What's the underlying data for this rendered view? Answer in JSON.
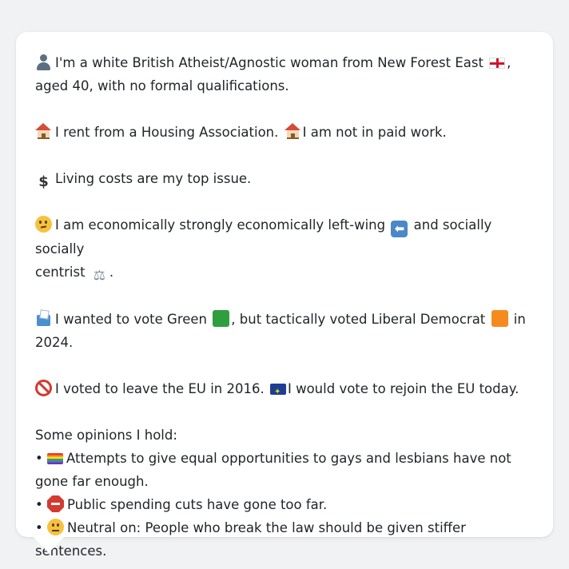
{
  "line1": {
    "text_a": "I'm a white British Atheist/Agnostic woman from New Forest East",
    "text_b": ",",
    "text_c": "aged 40, with no formal qualifications."
  },
  "housing": {
    "text_a": "I rent from a Housing Association.",
    "text_b": "I am not in paid work."
  },
  "issue": {
    "text": "Living costs are my top issue."
  },
  "politics": {
    "text_a": "I am economically strongly economically left-wing",
    "text_b": "and socially socially",
    "text_c": "centrist",
    "text_d": "."
  },
  "vote": {
    "text_a": "I wanted to vote Green",
    "text_b": ", but tactically voted Liberal Democrat",
    "text_c": "in",
    "text_d": "2024.",
    "green_color": "#2e9e3e",
    "libdem_color": "#f58b1f"
  },
  "eu": {
    "text_a": "I voted to leave the EU in 2016.",
    "text_b": "I would vote to rejoin the EU today."
  },
  "opinions": {
    "heading": "Some opinions I hold:",
    "bullet": "•",
    "items": [
      {
        "icon": "rainbow-flag-icon",
        "text_a": "Attempts to give equal opportunities to gays and lesbians have not",
        "text_b": "gone far enough."
      },
      {
        "icon": "stop-sign-icon",
        "text": "Public spending cuts have gone too far."
      },
      {
        "icon": "neutral-face-icon",
        "text": "Neutral on: People who break the law should be given stiffer sentences."
      }
    ]
  }
}
